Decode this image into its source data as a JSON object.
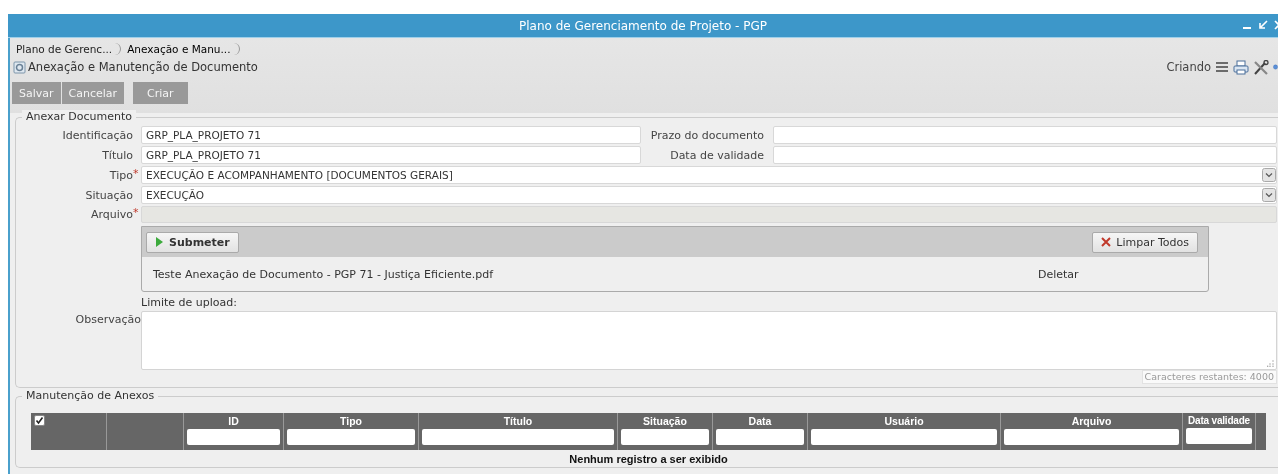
{
  "window": {
    "title": "Plano de Gerenciamento de Projeto - PGP"
  },
  "breadcrumbs": [
    {
      "label": "Plano de Gerenc...",
      "selected": false
    },
    {
      "label": "Anexação e Manu...",
      "selected": true
    }
  ],
  "page": {
    "title": "Anexação e Manutenção de Documento",
    "status": "Criando"
  },
  "toolbar": {
    "buttons": [
      {
        "label": "Salvar"
      },
      {
        "label": "Cancelar"
      },
      {
        "label": "Criar"
      }
    ]
  },
  "attach_section": {
    "legend": "Anexar Documento",
    "required_mark": "*",
    "fields": [
      {
        "kind": "pair",
        "label": "Identificação",
        "value": "GRP_PLA_PROJETO 71",
        "required": false,
        "side_label": "Prazo do documento"
      },
      {
        "kind": "pair",
        "label": "Título",
        "value": "GRP_PLA_PROJETO 71",
        "required": false,
        "side_label": "Data de validade"
      },
      {
        "kind": "select",
        "label": "Tipo",
        "value": "EXECUÇÃO E ACOMPANHAMENTO [DOCUMENTOS GERAIS]",
        "required": true
      },
      {
        "kind": "select",
        "label": "Situação",
        "value": "EXECUÇÃO",
        "required": false
      },
      {
        "kind": "file",
        "label": "Arquivo",
        "required": true
      }
    ],
    "uploader": {
      "submit": "Submeter",
      "clear": "Limpar Todos",
      "files": [
        {
          "name": "Teste Anexação de Documento - PGP 71 - Justiça Eficiente.pdf",
          "action": "Deletar"
        }
      ],
      "limit": "Limite de upload:"
    },
    "notes": {
      "label": "Observação",
      "counter": "Caracteres restantes: 4000"
    }
  },
  "attachments": {
    "legend": "Manutenção de Anexos",
    "select_all": {
      "checked": true
    },
    "columns": [
      {
        "label": "ID"
      },
      {
        "label": "Tipo"
      },
      {
        "label": "Título"
      },
      {
        "label": "Situação"
      },
      {
        "label": "Data"
      },
      {
        "label": "Usuário"
      },
      {
        "label": "Arquivo"
      },
      {
        "label": "Data validade"
      }
    ],
    "empty_message": "Nenhum registro a ser exibido"
  }
}
